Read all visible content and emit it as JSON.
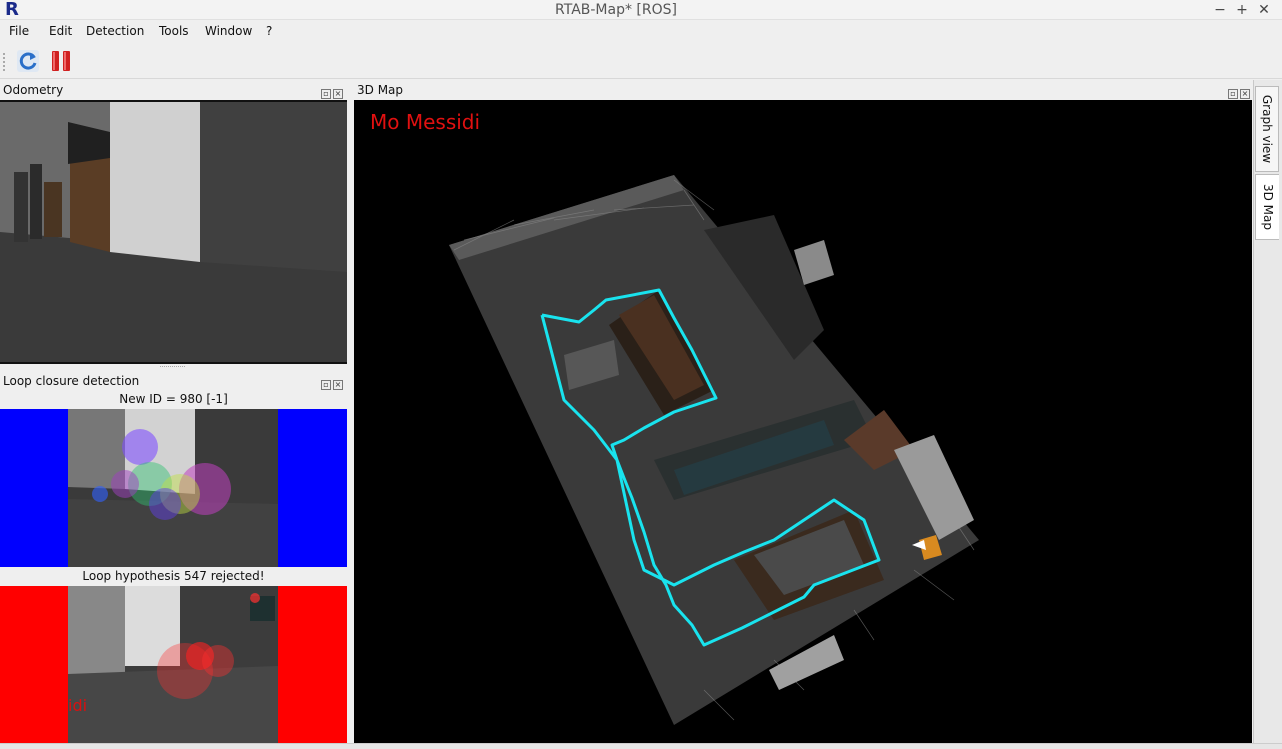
{
  "window": {
    "title": "RTAB-Map* [ROS]",
    "logo_letter": "R",
    "controls": {
      "minimize": "−",
      "maximize": "+",
      "close": "✕"
    }
  },
  "menu": [
    "File",
    "Edit",
    "Detection",
    "Tools",
    "Window",
    "?"
  ],
  "toolbar": {
    "buttons": [
      {
        "icon": "refresh-icon",
        "accent": "#2a6fc9"
      },
      {
        "icon": "pause-icon",
        "accent": "#d02020"
      }
    ]
  },
  "odometry": {
    "title": "Odometry"
  },
  "loop_closure": {
    "title": "Loop closure detection",
    "new_id_caption": "New ID = 980 [-1]",
    "hypothesis_caption": "Loop hypothesis 547 rejected!",
    "overlay_partial_text": "idi"
  },
  "map3d": {
    "title": "3D Map",
    "overlay_text": "Mo Messidi"
  },
  "side_tabs": [
    {
      "label": "Graph view",
      "active": false
    },
    {
      "label": "3D Map",
      "active": true
    }
  ],
  "colors": {
    "trajectory": "#19e3ee",
    "overlay_red": "#e01010",
    "new_id_border": "#0000ff",
    "hypothesis_border": "#ff0000"
  }
}
